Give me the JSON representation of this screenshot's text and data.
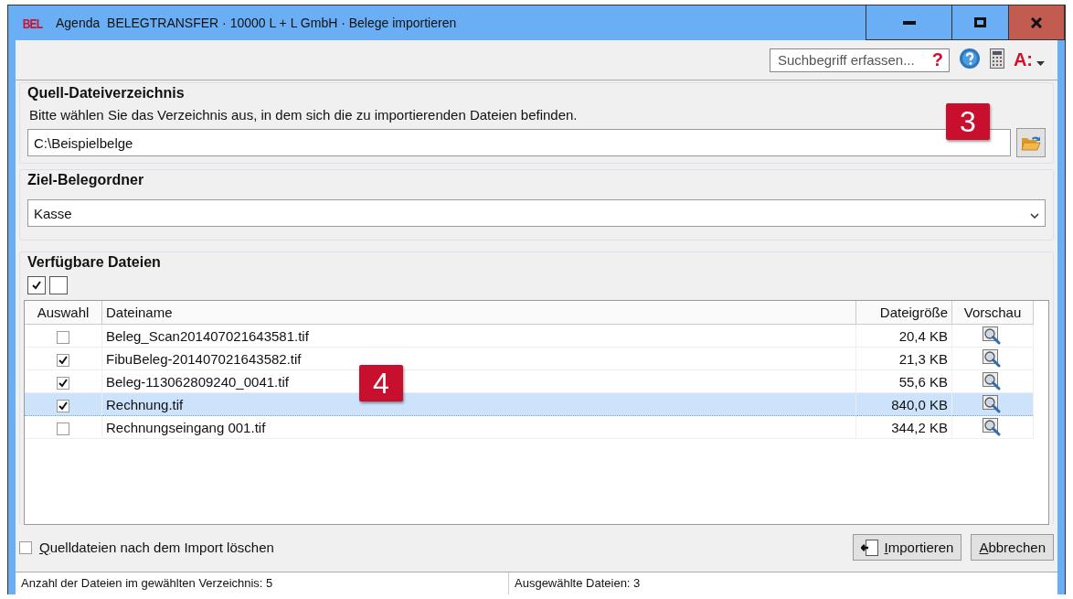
{
  "window": {
    "logo": "BEL",
    "title": "Agenda  BELEGTRANSFER · 10000 L + L GmbH · Belege importieren",
    "controls": [
      {
        "kind": "minimize"
      },
      {
        "kind": "maximize"
      },
      {
        "kind": "close"
      }
    ]
  },
  "toolbar": {
    "search": {
      "placeholder": "Suchbegriff erfassen...",
      "help_mark": "?"
    },
    "menu_label": "A:"
  },
  "source": {
    "heading": "Quell-Dateiverzeichnis",
    "instruction": "Bitte wählen Sie das Verzeichnis aus, in dem sich die zu importierenden Dateien befinden.",
    "path": "C:\\Beispielbelge"
  },
  "target": {
    "heading": "Ziel-Belegordner",
    "value": "Kasse"
  },
  "files": {
    "heading": "Verfügbare Dateien",
    "columns": [
      "Auswahl",
      "Dateiname",
      "Dateigröße",
      "Vorschau"
    ],
    "rows": [
      {
        "checked": false,
        "name": "Beleg_Scan201407021643581.tif",
        "size": "20,4 KB",
        "selected": false
      },
      {
        "checked": true,
        "name": "FibuBeleg-201407021643582.tif",
        "size": "21,3 KB",
        "selected": false
      },
      {
        "checked": true,
        "name": "Beleg-113062809240_0041.tif",
        "size": "55,6 KB",
        "selected": false
      },
      {
        "checked": true,
        "name": "Rechnung.tif",
        "size": "840,0 KB",
        "selected": true
      },
      {
        "checked": false,
        "name": "Rechnungseingang 001.tif",
        "size": "344,2 KB",
        "selected": false
      }
    ]
  },
  "delete_option": {
    "label": "Quelldateien nach dem Import löschen",
    "checked": false
  },
  "buttons": [
    {
      "kind": "import",
      "label": "Importieren"
    },
    {
      "kind": "cancel",
      "label": "Abbrechen"
    }
  ],
  "status_bar": [
    "Anzahl der Dateien im gewählten Verzeichnis: 5",
    "Ausgewählte Dateien: 3"
  ],
  "annotations": [
    {
      "text": "3"
    },
    {
      "text": "4"
    }
  ]
}
